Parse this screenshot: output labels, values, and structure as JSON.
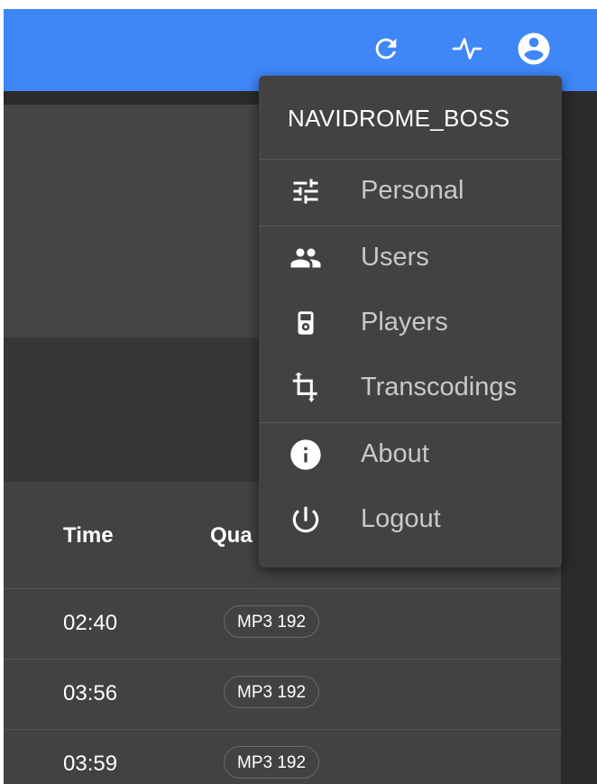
{
  "appbar": {
    "icons": [
      "refresh-icon",
      "activity-icon",
      "account-circle-icon"
    ]
  },
  "table": {
    "headers": {
      "time": "Time",
      "quality": "Qua"
    },
    "rows": [
      {
        "time": "02:40",
        "quality": "MP3 192"
      },
      {
        "time": "03:56",
        "quality": "MP3 192"
      },
      {
        "time": "03:59",
        "quality": "MP3 192"
      }
    ]
  },
  "user_menu": {
    "username": "NAVIDROME_BOSS",
    "items": [
      {
        "label": "Personal",
        "icon": "tune-icon"
      },
      {
        "label": "Users",
        "icon": "people-icon"
      },
      {
        "label": "Players",
        "icon": "player-device-icon"
      },
      {
        "label": "Transcodings",
        "icon": "crop-transcode-icon"
      },
      {
        "label": "About",
        "icon": "info-icon"
      },
      {
        "label": "Logout",
        "icon": "power-icon"
      }
    ]
  },
  "colors": {
    "appbar": "#3f86f7",
    "menu_bg": "#424242",
    "background": "#2b2b2b",
    "text_primary": "#ffffff",
    "text_secondary": "#c9c9c9"
  }
}
